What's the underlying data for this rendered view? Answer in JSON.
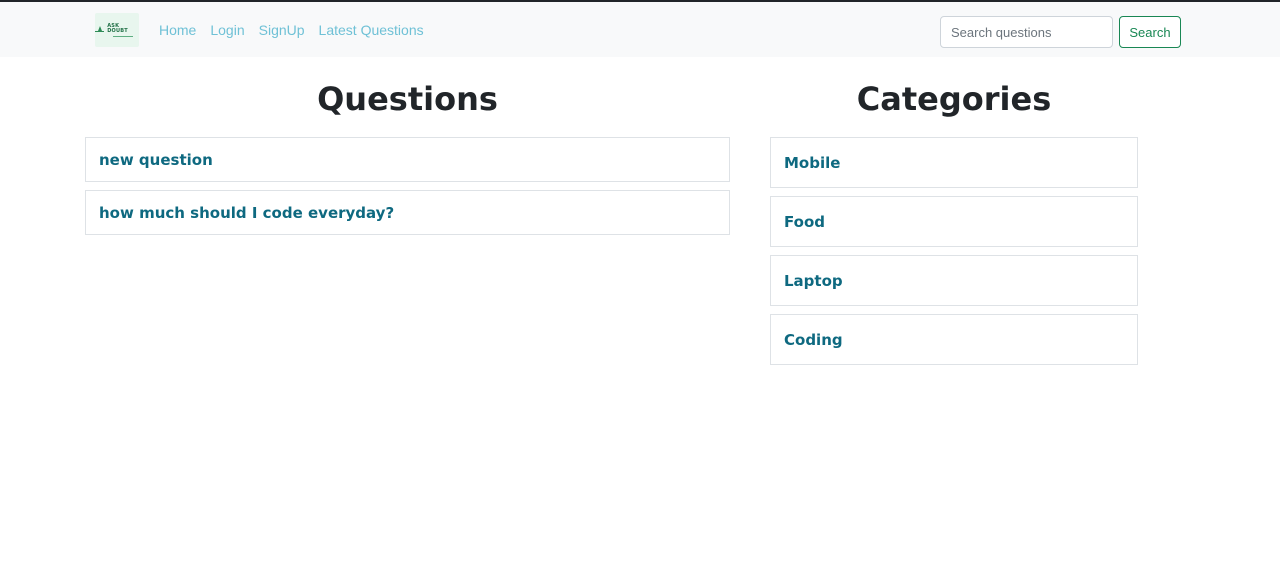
{
  "header": {
    "logo_text": "ASK DOUBT",
    "nav_links": [
      {
        "label": "Home"
      },
      {
        "label": "Login"
      },
      {
        "label": "SignUp"
      },
      {
        "label": "Latest Questions"
      }
    ],
    "search": {
      "placeholder": "Search questions",
      "value": "",
      "button_label": "Search"
    }
  },
  "questions": {
    "title": "Questions",
    "items": [
      {
        "label": "new question"
      },
      {
        "label": "how much should I code everyday?"
      }
    ]
  },
  "categories": {
    "title": "Categories",
    "items": [
      {
        "label": "Mobile"
      },
      {
        "label": "Food"
      },
      {
        "label": "Laptop"
      },
      {
        "label": "Coding"
      }
    ]
  },
  "colors": {
    "navbar_bg": "#f8f9fa",
    "nav_link": "#6fc1d6",
    "item_link": "#0e6980",
    "search_button": "#198754",
    "box_border": "#dee2e6"
  },
  "icons": {
    "logo": "ask-doubt-logo"
  }
}
